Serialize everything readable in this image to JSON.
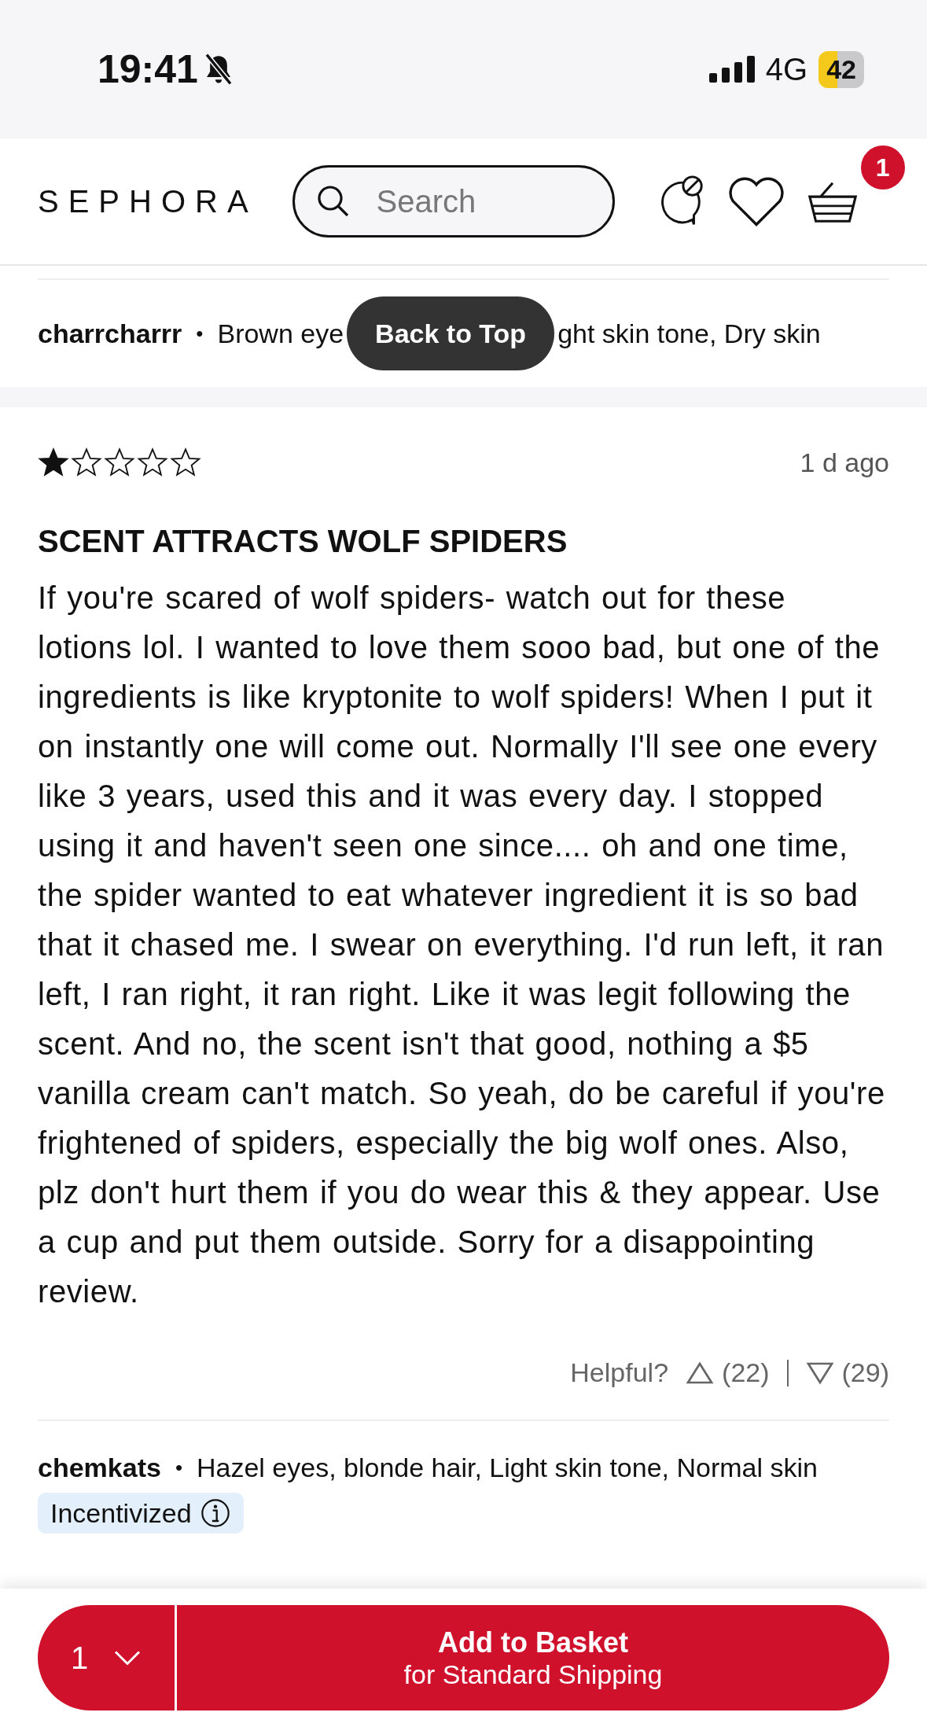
{
  "status_bar": {
    "time": "19:41",
    "network": "4G",
    "battery": "42"
  },
  "header": {
    "logo": "SEPHORA",
    "search": {
      "placeholder": "Search"
    },
    "basket_count": "1"
  },
  "previous_review": {
    "author": "charrcharrr",
    "separator": "•",
    "profile_before": "Brown eye",
    "profile_after": "ght skin tone, Dry skin"
  },
  "back_to_top": "Back to Top",
  "review": {
    "stars": 1,
    "date": "1 d ago",
    "title": "SCENT ATTRACTS WOLF SPIDERS",
    "body": "If you're scared of wolf spiders- watch out for these lotions lol. I wanted to love them sooo bad, but one of the ingredients is like kryptonite to wolf spiders! When I put it on instantly one will come out. Normally I'll see one every like 3 years, used this and it was every day. I stopped using it and haven't seen one since.... oh and one time, the spider wanted to eat whatever ingredient it is so bad that it chased me. I swear on everything. I'd run left, it ran left, I ran right, it ran right. Like it was legit following the scent. And no, the scent isn't that good, nothing a $5 vanilla cream can't match. So yeah, do be careful if you're frightened of spiders, especially the big wolf ones. Also, plz don't hurt them if you do wear this & they appear. Use a cup and put them outside. Sorry for a disappointing review.",
    "helpful_label": "Helpful?",
    "upvotes": "(22)",
    "downvotes": "(29)"
  },
  "next_review": {
    "author": "chemkats",
    "separator": "•",
    "profile": "Hazel eyes, blonde hair, Light skin tone, Normal skin",
    "badge": "Incentivized"
  },
  "bottom_bar": {
    "quantity": "1",
    "button_title": "Add to Basket",
    "button_subtitle": "for Standard Shipping"
  }
}
